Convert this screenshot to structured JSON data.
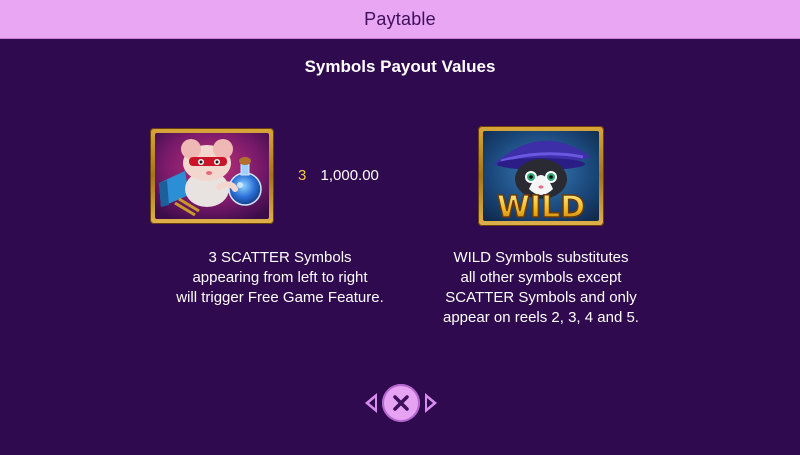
{
  "header": {
    "title": "Paytable"
  },
  "section": {
    "title": "Symbols Payout Values"
  },
  "symbols": {
    "scatter": {
      "icon": "scatter-mouse-symbol",
      "payout_count": "3",
      "payout_value": "1,000.00",
      "description": [
        "3 SCATTER Symbols",
        "appearing from left to right",
        "will trigger Free Game Feature."
      ]
    },
    "wild": {
      "icon": "wild-cat-symbol",
      "label": "WILD",
      "description": [
        "WILD Symbols substitutes",
        "all other symbols except",
        "SCATTER Symbols and only",
        "appear on reels 2, 3, 4 and 5."
      ]
    }
  },
  "nav": {
    "prev_icon": "chevron-left-icon",
    "close_icon": "close-icon",
    "next_icon": "chevron-right-icon"
  },
  "colors": {
    "background": "#2f0a4e",
    "header": "#e9a6f2",
    "payout_count": "#f4c64a",
    "nav_accent": "#d98cf0"
  }
}
